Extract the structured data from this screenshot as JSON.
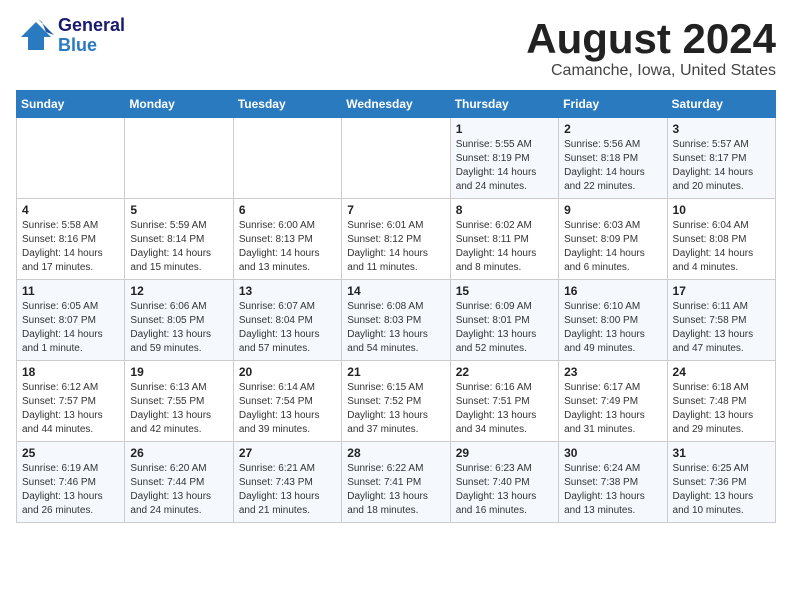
{
  "logo": {
    "general": "General",
    "blue": "Blue"
  },
  "title": "August 2024",
  "location": "Camanche, Iowa, United States",
  "days_of_week": [
    "Sunday",
    "Monday",
    "Tuesday",
    "Wednesday",
    "Thursday",
    "Friday",
    "Saturday"
  ],
  "weeks": [
    [
      {
        "day": "",
        "content": ""
      },
      {
        "day": "",
        "content": ""
      },
      {
        "day": "",
        "content": ""
      },
      {
        "day": "",
        "content": ""
      },
      {
        "day": "1",
        "content": "Sunrise: 5:55 AM\nSunset: 8:19 PM\nDaylight: 14 hours and 24 minutes."
      },
      {
        "day": "2",
        "content": "Sunrise: 5:56 AM\nSunset: 8:18 PM\nDaylight: 14 hours and 22 minutes."
      },
      {
        "day": "3",
        "content": "Sunrise: 5:57 AM\nSunset: 8:17 PM\nDaylight: 14 hours and 20 minutes."
      }
    ],
    [
      {
        "day": "4",
        "content": "Sunrise: 5:58 AM\nSunset: 8:16 PM\nDaylight: 14 hours and 17 minutes."
      },
      {
        "day": "5",
        "content": "Sunrise: 5:59 AM\nSunset: 8:14 PM\nDaylight: 14 hours and 15 minutes."
      },
      {
        "day": "6",
        "content": "Sunrise: 6:00 AM\nSunset: 8:13 PM\nDaylight: 14 hours and 13 minutes."
      },
      {
        "day": "7",
        "content": "Sunrise: 6:01 AM\nSunset: 8:12 PM\nDaylight: 14 hours and 11 minutes."
      },
      {
        "day": "8",
        "content": "Sunrise: 6:02 AM\nSunset: 8:11 PM\nDaylight: 14 hours and 8 minutes."
      },
      {
        "day": "9",
        "content": "Sunrise: 6:03 AM\nSunset: 8:09 PM\nDaylight: 14 hours and 6 minutes."
      },
      {
        "day": "10",
        "content": "Sunrise: 6:04 AM\nSunset: 8:08 PM\nDaylight: 14 hours and 4 minutes."
      }
    ],
    [
      {
        "day": "11",
        "content": "Sunrise: 6:05 AM\nSunset: 8:07 PM\nDaylight: 14 hours and 1 minute."
      },
      {
        "day": "12",
        "content": "Sunrise: 6:06 AM\nSunset: 8:05 PM\nDaylight: 13 hours and 59 minutes."
      },
      {
        "day": "13",
        "content": "Sunrise: 6:07 AM\nSunset: 8:04 PM\nDaylight: 13 hours and 57 minutes."
      },
      {
        "day": "14",
        "content": "Sunrise: 6:08 AM\nSunset: 8:03 PM\nDaylight: 13 hours and 54 minutes."
      },
      {
        "day": "15",
        "content": "Sunrise: 6:09 AM\nSunset: 8:01 PM\nDaylight: 13 hours and 52 minutes."
      },
      {
        "day": "16",
        "content": "Sunrise: 6:10 AM\nSunset: 8:00 PM\nDaylight: 13 hours and 49 minutes."
      },
      {
        "day": "17",
        "content": "Sunrise: 6:11 AM\nSunset: 7:58 PM\nDaylight: 13 hours and 47 minutes."
      }
    ],
    [
      {
        "day": "18",
        "content": "Sunrise: 6:12 AM\nSunset: 7:57 PM\nDaylight: 13 hours and 44 minutes."
      },
      {
        "day": "19",
        "content": "Sunrise: 6:13 AM\nSunset: 7:55 PM\nDaylight: 13 hours and 42 minutes."
      },
      {
        "day": "20",
        "content": "Sunrise: 6:14 AM\nSunset: 7:54 PM\nDaylight: 13 hours and 39 minutes."
      },
      {
        "day": "21",
        "content": "Sunrise: 6:15 AM\nSunset: 7:52 PM\nDaylight: 13 hours and 37 minutes."
      },
      {
        "day": "22",
        "content": "Sunrise: 6:16 AM\nSunset: 7:51 PM\nDaylight: 13 hours and 34 minutes."
      },
      {
        "day": "23",
        "content": "Sunrise: 6:17 AM\nSunset: 7:49 PM\nDaylight: 13 hours and 31 minutes."
      },
      {
        "day": "24",
        "content": "Sunrise: 6:18 AM\nSunset: 7:48 PM\nDaylight: 13 hours and 29 minutes."
      }
    ],
    [
      {
        "day": "25",
        "content": "Sunrise: 6:19 AM\nSunset: 7:46 PM\nDaylight: 13 hours and 26 minutes."
      },
      {
        "day": "26",
        "content": "Sunrise: 6:20 AM\nSunset: 7:44 PM\nDaylight: 13 hours and 24 minutes."
      },
      {
        "day": "27",
        "content": "Sunrise: 6:21 AM\nSunset: 7:43 PM\nDaylight: 13 hours and 21 minutes."
      },
      {
        "day": "28",
        "content": "Sunrise: 6:22 AM\nSunset: 7:41 PM\nDaylight: 13 hours and 18 minutes."
      },
      {
        "day": "29",
        "content": "Sunrise: 6:23 AM\nSunset: 7:40 PM\nDaylight: 13 hours and 16 minutes."
      },
      {
        "day": "30",
        "content": "Sunrise: 6:24 AM\nSunset: 7:38 PM\nDaylight: 13 hours and 13 minutes."
      },
      {
        "day": "31",
        "content": "Sunrise: 6:25 AM\nSunset: 7:36 PM\nDaylight: 13 hours and 10 minutes."
      }
    ]
  ]
}
